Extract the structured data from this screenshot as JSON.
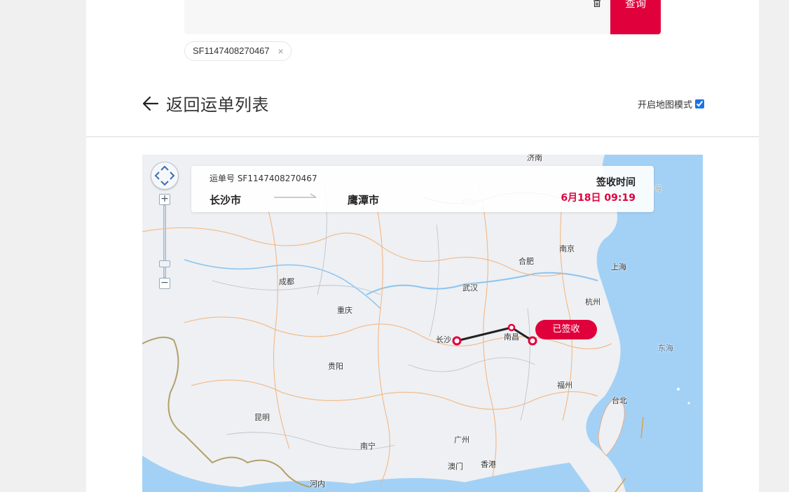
{
  "search": {
    "query_label": "查询",
    "tags": [
      {
        "text": "SF1147408270467",
        "close": "×"
      }
    ]
  },
  "header": {
    "back_label": "返回运单列表",
    "map_mode_label": "开启地图模式",
    "map_mode_checked": true
  },
  "map": {
    "zoom_in": "+",
    "zoom_out": "−",
    "cities": {
      "jinan": "济南",
      "zhengzhou": "郑州",
      "nanjing": "南京",
      "hefei": "合肥",
      "shanghai": "上海",
      "chengdu": "成都",
      "wuhan": "武汉",
      "hangzhou": "杭州",
      "chongqing": "重庆",
      "changsha": "长沙",
      "nanchang": "南昌",
      "guiyang": "贵阳",
      "fuzhou": "福州",
      "kunming": "昆明",
      "taibei": "台北",
      "guangzhou": "广州",
      "nanning": "南宁",
      "aomen": "澳门",
      "xianggang": "香港",
      "hanoi": "河内",
      "donghai": "东海",
      "qingdao_partial": "黄海"
    },
    "route_color": "#222222",
    "marker_color": "#e0003c"
  },
  "info": {
    "waybill": "运单号 SF1147408270467",
    "origin": "长沙市",
    "destination": "鹰潭市",
    "signed_time_label": "签收时间",
    "signed_time_value": "6月18日 09:19",
    "status_badge": "已签收"
  },
  "colors": {
    "accent": "#e0003c",
    "sea": "#a3d1f5",
    "land": "#eef0f3"
  }
}
